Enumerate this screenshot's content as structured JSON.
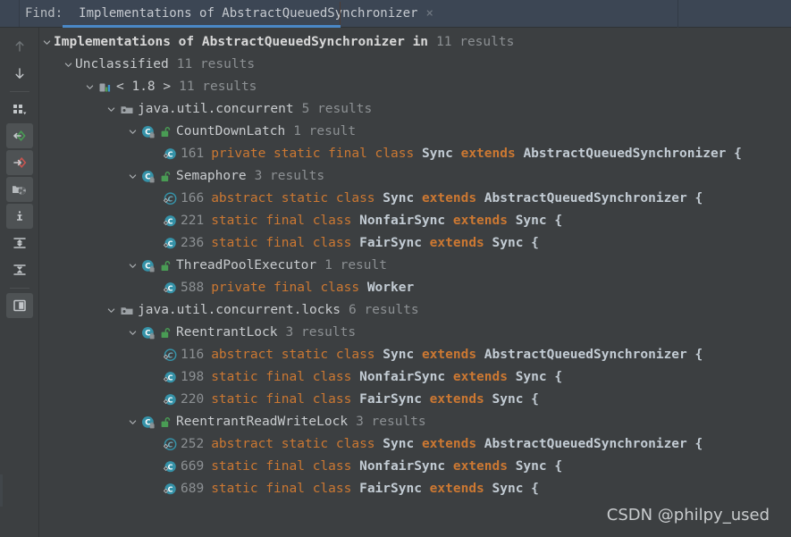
{
  "header": {
    "find_label": "Find:",
    "tab_title": "Implementations of AbstractQueuedSynchronizer",
    "tab_close": "×",
    "accent_color": "#4a88c7",
    "background_color": "#3c4654"
  },
  "sidebar": {
    "items": [
      {
        "name": "previous-occurrence-icon",
        "tooltip": "Previous Occurrence",
        "active": false
      },
      {
        "name": "next-occurrence-icon",
        "tooltip": "Next Occurrence",
        "active": false
      },
      {
        "name": "group-by-icon",
        "tooltip": "Group By",
        "active": false
      },
      {
        "name": "expand-all-usages-icon",
        "tooltip": "Show Read Access",
        "active": true
      },
      {
        "name": "show-write-access-icon",
        "tooltip": "Show Write Access",
        "active": true
      },
      {
        "name": "filter-icon",
        "tooltip": "Filter",
        "active": true
      },
      {
        "name": "info-icon",
        "tooltip": "Usage Info",
        "active": true
      },
      {
        "name": "expand-all-icon",
        "tooltip": "Expand All",
        "active": false
      },
      {
        "name": "collapse-all-icon",
        "tooltip": "Collapse All",
        "active": false
      },
      {
        "name": "preview-panel-icon",
        "tooltip": "Preview Source",
        "active": true
      }
    ]
  },
  "watermark": "CSDN @philpy_used",
  "tree": {
    "rows": [
      {
        "indent": 0,
        "twisty": "expanded",
        "icon": "none",
        "vis": "none",
        "kind": "title",
        "label": "Implementations of AbstractQueuedSynchronizer in",
        "count": "11 results"
      },
      {
        "indent": 1,
        "twisty": "expanded",
        "icon": "none",
        "vis": "none",
        "kind": "group",
        "label": "Unclassified",
        "count": "11 results"
      },
      {
        "indent": 2,
        "twisty": "expanded",
        "icon": "module",
        "vis": "none",
        "kind": "group",
        "label": "< 1.8 >",
        "count": "11 results"
      },
      {
        "indent": 3,
        "twisty": "expanded",
        "icon": "package",
        "vis": "none",
        "kind": "package",
        "label": "java.util.concurrent",
        "count": "5 results"
      },
      {
        "indent": 4,
        "twisty": "expanded",
        "icon": "class",
        "vis": "public",
        "kind": "class",
        "label": "CountDownLatch",
        "count": "1 result"
      },
      {
        "indent": 5,
        "twisty": "none",
        "icon": "inner-class",
        "vis": "none",
        "kind": "code",
        "linenum": "161",
        "tokens": [
          {
            "t": "private ",
            "c": "kw"
          },
          {
            "t": "static ",
            "c": "kw"
          },
          {
            "t": "final ",
            "c": "kw"
          },
          {
            "t": "class ",
            "c": "kw"
          },
          {
            "t": "Sync ",
            "c": "cls"
          },
          {
            "t": "extends ",
            "c": "kwb"
          },
          {
            "t": "AbstractQueuedSynchronizer ",
            "c": "cls"
          },
          {
            "t": "{",
            "c": "brace"
          }
        ]
      },
      {
        "indent": 4,
        "twisty": "expanded",
        "icon": "class",
        "vis": "public",
        "kind": "class",
        "label": "Semaphore",
        "count": "3 results"
      },
      {
        "indent": 5,
        "twisty": "none",
        "icon": "inner-class-abstract",
        "vis": "none",
        "kind": "code",
        "linenum": "166",
        "tokens": [
          {
            "t": "abstract ",
            "c": "kw"
          },
          {
            "t": "static ",
            "c": "kw"
          },
          {
            "t": "class ",
            "c": "kw"
          },
          {
            "t": "Sync ",
            "c": "cls"
          },
          {
            "t": "extends ",
            "c": "kwb"
          },
          {
            "t": "AbstractQueuedSynchronizer ",
            "c": "cls"
          },
          {
            "t": "{",
            "c": "brace"
          }
        ]
      },
      {
        "indent": 5,
        "twisty": "none",
        "icon": "inner-class",
        "vis": "none",
        "kind": "code",
        "linenum": "221",
        "tokens": [
          {
            "t": "static ",
            "c": "kw"
          },
          {
            "t": "final ",
            "c": "kw"
          },
          {
            "t": "class ",
            "c": "kw"
          },
          {
            "t": "NonfairSync ",
            "c": "cls"
          },
          {
            "t": "extends ",
            "c": "kwb"
          },
          {
            "t": "Sync ",
            "c": "cls"
          },
          {
            "t": "{",
            "c": "brace"
          }
        ]
      },
      {
        "indent": 5,
        "twisty": "none",
        "icon": "inner-class",
        "vis": "none",
        "kind": "code",
        "linenum": "236",
        "tokens": [
          {
            "t": "static ",
            "c": "kw"
          },
          {
            "t": "final ",
            "c": "kw"
          },
          {
            "t": "class ",
            "c": "kw"
          },
          {
            "t": "FairSync ",
            "c": "cls"
          },
          {
            "t": "extends ",
            "c": "kwb"
          },
          {
            "t": "Sync ",
            "c": "cls"
          },
          {
            "t": "{",
            "c": "brace"
          }
        ]
      },
      {
        "indent": 4,
        "twisty": "expanded",
        "icon": "class",
        "vis": "public",
        "kind": "class",
        "label": "ThreadPoolExecutor",
        "count": "1 result"
      },
      {
        "indent": 5,
        "twisty": "none",
        "icon": "inner-class",
        "vis": "none",
        "kind": "code",
        "linenum": "588",
        "tokens": [
          {
            "t": "private ",
            "c": "kw"
          },
          {
            "t": "final ",
            "c": "kw"
          },
          {
            "t": "class ",
            "c": "kw"
          },
          {
            "t": "Worker",
            "c": "cls"
          }
        ]
      },
      {
        "indent": 3,
        "twisty": "expanded",
        "icon": "package",
        "vis": "none",
        "kind": "package",
        "label": "java.util.concurrent.locks",
        "count": "6 results"
      },
      {
        "indent": 4,
        "twisty": "expanded",
        "icon": "class",
        "vis": "public",
        "kind": "class",
        "label": "ReentrantLock",
        "count": "3 results"
      },
      {
        "indent": 5,
        "twisty": "none",
        "icon": "inner-class-abstract",
        "vis": "none",
        "kind": "code",
        "linenum": "116",
        "tokens": [
          {
            "t": "abstract ",
            "c": "kw"
          },
          {
            "t": "static ",
            "c": "kw"
          },
          {
            "t": "class ",
            "c": "kw"
          },
          {
            "t": "Sync ",
            "c": "cls"
          },
          {
            "t": "extends ",
            "c": "kwb"
          },
          {
            "t": "AbstractQueuedSynchronizer ",
            "c": "cls"
          },
          {
            "t": "{",
            "c": "brace"
          }
        ]
      },
      {
        "indent": 5,
        "twisty": "none",
        "icon": "inner-class",
        "vis": "none",
        "kind": "code",
        "linenum": "198",
        "tokens": [
          {
            "t": "static ",
            "c": "kw"
          },
          {
            "t": "final ",
            "c": "kw"
          },
          {
            "t": "class ",
            "c": "kw"
          },
          {
            "t": "NonfairSync ",
            "c": "cls"
          },
          {
            "t": "extends ",
            "c": "kwb"
          },
          {
            "t": "Sync ",
            "c": "cls"
          },
          {
            "t": "{",
            "c": "brace"
          }
        ]
      },
      {
        "indent": 5,
        "twisty": "none",
        "icon": "inner-class",
        "vis": "none",
        "kind": "code",
        "linenum": "220",
        "tokens": [
          {
            "t": "static ",
            "c": "kw"
          },
          {
            "t": "final ",
            "c": "kw"
          },
          {
            "t": "class ",
            "c": "kw"
          },
          {
            "t": "FairSync ",
            "c": "cls"
          },
          {
            "t": "extends ",
            "c": "kwb"
          },
          {
            "t": "Sync ",
            "c": "cls"
          },
          {
            "t": "{",
            "c": "brace"
          }
        ]
      },
      {
        "indent": 4,
        "twisty": "expanded",
        "icon": "class",
        "vis": "public",
        "kind": "class",
        "label": "ReentrantReadWriteLock",
        "count": "3 results"
      },
      {
        "indent": 5,
        "twisty": "none",
        "icon": "inner-class-abstract",
        "vis": "none",
        "kind": "code",
        "linenum": "252",
        "tokens": [
          {
            "t": "abstract ",
            "c": "kw"
          },
          {
            "t": "static ",
            "c": "kw"
          },
          {
            "t": "class ",
            "c": "kw"
          },
          {
            "t": "Sync ",
            "c": "cls"
          },
          {
            "t": "extends ",
            "c": "kwb"
          },
          {
            "t": "AbstractQueuedSynchronizer ",
            "c": "cls"
          },
          {
            "t": "{",
            "c": "brace"
          }
        ]
      },
      {
        "indent": 5,
        "twisty": "none",
        "icon": "inner-class",
        "vis": "none",
        "kind": "code",
        "linenum": "669",
        "tokens": [
          {
            "t": "static ",
            "c": "kw"
          },
          {
            "t": "final ",
            "c": "kw"
          },
          {
            "t": "class ",
            "c": "kw"
          },
          {
            "t": "NonfairSync ",
            "c": "cls"
          },
          {
            "t": "extends ",
            "c": "kwb"
          },
          {
            "t": "Sync ",
            "c": "cls"
          },
          {
            "t": "{",
            "c": "brace"
          }
        ]
      },
      {
        "indent": 5,
        "twisty": "none",
        "icon": "inner-class",
        "vis": "none",
        "kind": "code",
        "linenum": "689",
        "tokens": [
          {
            "t": "static ",
            "c": "kw"
          },
          {
            "t": "final ",
            "c": "kw"
          },
          {
            "t": "class ",
            "c": "kw"
          },
          {
            "t": "FairSync ",
            "c": "cls"
          },
          {
            "t": "extends ",
            "c": "kwb"
          },
          {
            "t": "Sync ",
            "c": "cls"
          },
          {
            "t": "{",
            "c": "brace"
          }
        ]
      }
    ]
  }
}
